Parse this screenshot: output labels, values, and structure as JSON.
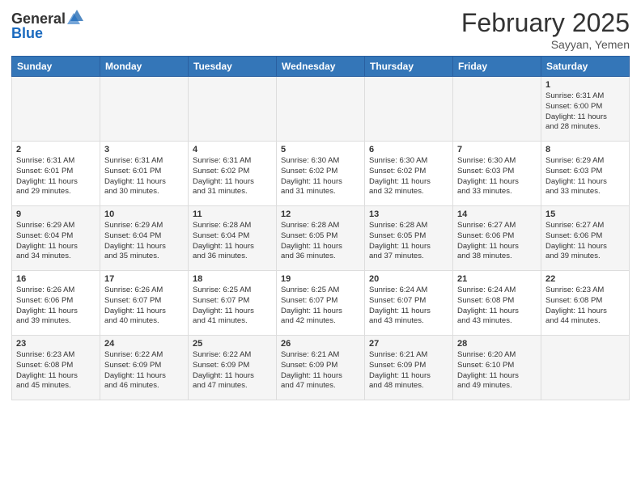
{
  "header": {
    "logo_general": "General",
    "logo_blue": "Blue",
    "title": "February 2025",
    "subtitle": "Sayyan, Yemen"
  },
  "days_of_week": [
    "Sunday",
    "Monday",
    "Tuesday",
    "Wednesday",
    "Thursday",
    "Friday",
    "Saturday"
  ],
  "weeks": [
    [
      {
        "day": "",
        "info": ""
      },
      {
        "day": "",
        "info": ""
      },
      {
        "day": "",
        "info": ""
      },
      {
        "day": "",
        "info": ""
      },
      {
        "day": "",
        "info": ""
      },
      {
        "day": "",
        "info": ""
      },
      {
        "day": "1",
        "info": "Sunrise: 6:31 AM\nSunset: 6:00 PM\nDaylight: 11 hours\nand 28 minutes."
      }
    ],
    [
      {
        "day": "2",
        "info": "Sunrise: 6:31 AM\nSunset: 6:01 PM\nDaylight: 11 hours\nand 29 minutes."
      },
      {
        "day": "3",
        "info": "Sunrise: 6:31 AM\nSunset: 6:01 PM\nDaylight: 11 hours\nand 30 minutes."
      },
      {
        "day": "4",
        "info": "Sunrise: 6:31 AM\nSunset: 6:02 PM\nDaylight: 11 hours\nand 31 minutes."
      },
      {
        "day": "5",
        "info": "Sunrise: 6:30 AM\nSunset: 6:02 PM\nDaylight: 11 hours\nand 31 minutes."
      },
      {
        "day": "6",
        "info": "Sunrise: 6:30 AM\nSunset: 6:02 PM\nDaylight: 11 hours\nand 32 minutes."
      },
      {
        "day": "7",
        "info": "Sunrise: 6:30 AM\nSunset: 6:03 PM\nDaylight: 11 hours\nand 33 minutes."
      },
      {
        "day": "8",
        "info": "Sunrise: 6:29 AM\nSunset: 6:03 PM\nDaylight: 11 hours\nand 33 minutes."
      }
    ],
    [
      {
        "day": "9",
        "info": "Sunrise: 6:29 AM\nSunset: 6:04 PM\nDaylight: 11 hours\nand 34 minutes."
      },
      {
        "day": "10",
        "info": "Sunrise: 6:29 AM\nSunset: 6:04 PM\nDaylight: 11 hours\nand 35 minutes."
      },
      {
        "day": "11",
        "info": "Sunrise: 6:28 AM\nSunset: 6:04 PM\nDaylight: 11 hours\nand 36 minutes."
      },
      {
        "day": "12",
        "info": "Sunrise: 6:28 AM\nSunset: 6:05 PM\nDaylight: 11 hours\nand 36 minutes."
      },
      {
        "day": "13",
        "info": "Sunrise: 6:28 AM\nSunset: 6:05 PM\nDaylight: 11 hours\nand 37 minutes."
      },
      {
        "day": "14",
        "info": "Sunrise: 6:27 AM\nSunset: 6:06 PM\nDaylight: 11 hours\nand 38 minutes."
      },
      {
        "day": "15",
        "info": "Sunrise: 6:27 AM\nSunset: 6:06 PM\nDaylight: 11 hours\nand 39 minutes."
      }
    ],
    [
      {
        "day": "16",
        "info": "Sunrise: 6:26 AM\nSunset: 6:06 PM\nDaylight: 11 hours\nand 39 minutes."
      },
      {
        "day": "17",
        "info": "Sunrise: 6:26 AM\nSunset: 6:07 PM\nDaylight: 11 hours\nand 40 minutes."
      },
      {
        "day": "18",
        "info": "Sunrise: 6:25 AM\nSunset: 6:07 PM\nDaylight: 11 hours\nand 41 minutes."
      },
      {
        "day": "19",
        "info": "Sunrise: 6:25 AM\nSunset: 6:07 PM\nDaylight: 11 hours\nand 42 minutes."
      },
      {
        "day": "20",
        "info": "Sunrise: 6:24 AM\nSunset: 6:07 PM\nDaylight: 11 hours\nand 43 minutes."
      },
      {
        "day": "21",
        "info": "Sunrise: 6:24 AM\nSunset: 6:08 PM\nDaylight: 11 hours\nand 43 minutes."
      },
      {
        "day": "22",
        "info": "Sunrise: 6:23 AM\nSunset: 6:08 PM\nDaylight: 11 hours\nand 44 minutes."
      }
    ],
    [
      {
        "day": "23",
        "info": "Sunrise: 6:23 AM\nSunset: 6:08 PM\nDaylight: 11 hours\nand 45 minutes."
      },
      {
        "day": "24",
        "info": "Sunrise: 6:22 AM\nSunset: 6:09 PM\nDaylight: 11 hours\nand 46 minutes."
      },
      {
        "day": "25",
        "info": "Sunrise: 6:22 AM\nSunset: 6:09 PM\nDaylight: 11 hours\nand 47 minutes."
      },
      {
        "day": "26",
        "info": "Sunrise: 6:21 AM\nSunset: 6:09 PM\nDaylight: 11 hours\nand 47 minutes."
      },
      {
        "day": "27",
        "info": "Sunrise: 6:21 AM\nSunset: 6:09 PM\nDaylight: 11 hours\nand 48 minutes."
      },
      {
        "day": "28",
        "info": "Sunrise: 6:20 AM\nSunset: 6:10 PM\nDaylight: 11 hours\nand 49 minutes."
      },
      {
        "day": "",
        "info": ""
      }
    ]
  ]
}
